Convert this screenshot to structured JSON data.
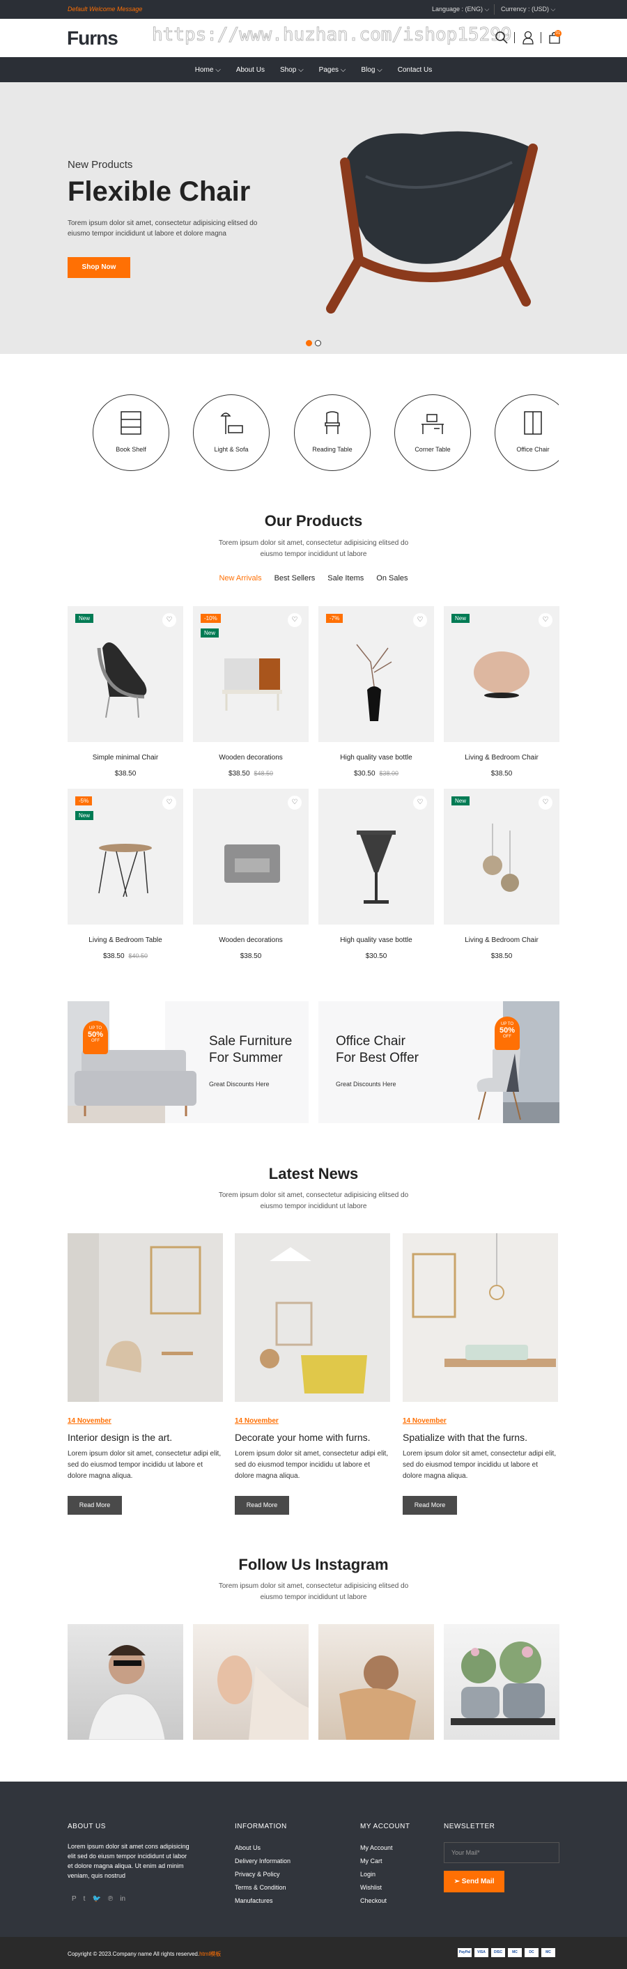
{
  "topbar": {
    "welcome": "Default Welcome Message",
    "language": "Language : (ENG) ⌵",
    "currency": "Currency : (USD) ⌵"
  },
  "header": {
    "logo": "Furns",
    "watermark": "https://www.huzhan.com/ishop15299",
    "cart_count": "01"
  },
  "nav": [
    {
      "label": "Home ⌵"
    },
    {
      "label": "About Us"
    },
    {
      "label": "Shop ⌵"
    },
    {
      "label": "Pages ⌵"
    },
    {
      "label": "Blog ⌵"
    },
    {
      "label": "Contact Us"
    }
  ],
  "hero": {
    "subtitle": "New Products",
    "title": "Flexible Chair",
    "description": "Torem ipsum dolor sit amet, consectetur adipisicing elitsed do eiusmo tempor incididunt ut labore et dolore magna",
    "button": "Shop Now",
    "slides": 2,
    "active_slide": 1
  },
  "categories": [
    {
      "label": "Book Shelf"
    },
    {
      "label": "Light & Sofa"
    },
    {
      "label": "Reading Table"
    },
    {
      "label": "Corner Table"
    },
    {
      "label": "Office Chair"
    }
  ],
  "products": {
    "title": "Our Products",
    "description": "Torem ipsum dolor sit amet, consectetur adipisicing elitsed do eiusmo tempor incididunt ut labore",
    "tabs": [
      {
        "label": "New Arrivals",
        "active": true
      },
      {
        "label": "Best Sellers"
      },
      {
        "label": "Sale Items"
      },
      {
        "label": "On Sales"
      }
    ],
    "items": [
      {
        "name": "Simple minimal Chair",
        "price": "$38.50",
        "old": "",
        "tags": [
          "New"
        ]
      },
      {
        "name": "Wooden decorations",
        "price": "$38.50",
        "old": "$48.50",
        "tags": [
          "-10%",
          "New"
        ]
      },
      {
        "name": "High quality vase bottle",
        "price": "$30.50",
        "old": "$38.00",
        "tags": [
          "-7%"
        ]
      },
      {
        "name": "Living & Bedroom Chair",
        "price": "$38.50",
        "old": "",
        "tags": [
          "New"
        ]
      },
      {
        "name": "Living & Bedroom Table",
        "price": "$38.50",
        "old": "$40.50",
        "tags": [
          "-5%",
          "New"
        ]
      },
      {
        "name": "Wooden decorations",
        "price": "$38.50",
        "old": "",
        "tags": []
      },
      {
        "name": "High quality vase bottle",
        "price": "$30.50",
        "old": "",
        "tags": []
      },
      {
        "name": "Living & Bedroom Chair",
        "price": "$38.50",
        "old": "",
        "tags": [
          "New"
        ]
      }
    ]
  },
  "banners": [
    {
      "line1": "Sale Furniture",
      "line2": "For Summer",
      "sub": "Great Discounts Here",
      "badge_top": "UP TO",
      "badge_pct": "50%",
      "badge_bottom": "OFF"
    },
    {
      "line1": "Office Chair",
      "line2": "For Best Offer",
      "sub": "Great Discounts Here",
      "badge_top": "UP TO",
      "badge_pct": "50%",
      "badge_bottom": "OFF"
    }
  ],
  "news": {
    "title": "Latest News",
    "description": "Torem ipsum dolor sit amet, consectetur adipisicing elitsed do eiusmo tempor incididunt ut labore",
    "items": [
      {
        "date": "14 November",
        "title": "Interior design is the art.",
        "text": "Lorem ipsum dolor sit amet, consectetur adipi elit, sed do eiusmod tempor incididu ut labore et dolore magna aliqua.",
        "button": "Read More"
      },
      {
        "date": "14 November",
        "title": "Decorate your home with furns.",
        "text": "Lorem ipsum dolor sit amet, consectetur adipi elit, sed do eiusmod tempor incididu ut labore et dolore magna aliqua.",
        "button": "Read More"
      },
      {
        "date": "14 November",
        "title": "Spatialize with that the furns.",
        "text": "Lorem ipsum dolor sit amet, consectetur adipi elit, sed do eiusmod tempor incididu ut labore et dolore magna aliqua.",
        "button": "Read More"
      }
    ]
  },
  "instagram": {
    "title": "Follow Us Instagram",
    "description": "Torem ipsum dolor sit amet, consectetur adipisicing elitsed do eiusmo tempor incididunt ut labore"
  },
  "footer": {
    "about_title": "ABOUT US",
    "about_text": "Lorem ipsum dolor sit amet cons adipisicing elit sed do eiusm tempor incididunt ut labor et dolore magna aliqua. Ut enim ad minim veniam, quis nostrud",
    "info_title": "INFORMATION",
    "info_links": [
      "About Us",
      "Delivery Information",
      "Privacy & Policy",
      "Terms & Condition",
      "Manufactures"
    ],
    "account_title": "MY ACCOUNT",
    "account_links": [
      "My Account",
      "My Cart",
      "Login",
      "Wishlist",
      "Checkout"
    ],
    "newsletter_title": "NEWSLETTER",
    "mail_placeholder": "Your Mail*",
    "send_label": "Send Mail",
    "social": [
      "P",
      "t",
      "🐦",
      "℗",
      "in"
    ],
    "copyright": "Copyright © 2023.Company name All rights reserved.",
    "copyright_link": "html模板",
    "payments": [
      "PayPal",
      "VISA",
      "DISC",
      "MC",
      "DC",
      "MC"
    ]
  },
  "colors": {
    "accent": "#ff7004",
    "dark": "#2b2f36",
    "new_tag": "#007b54"
  }
}
